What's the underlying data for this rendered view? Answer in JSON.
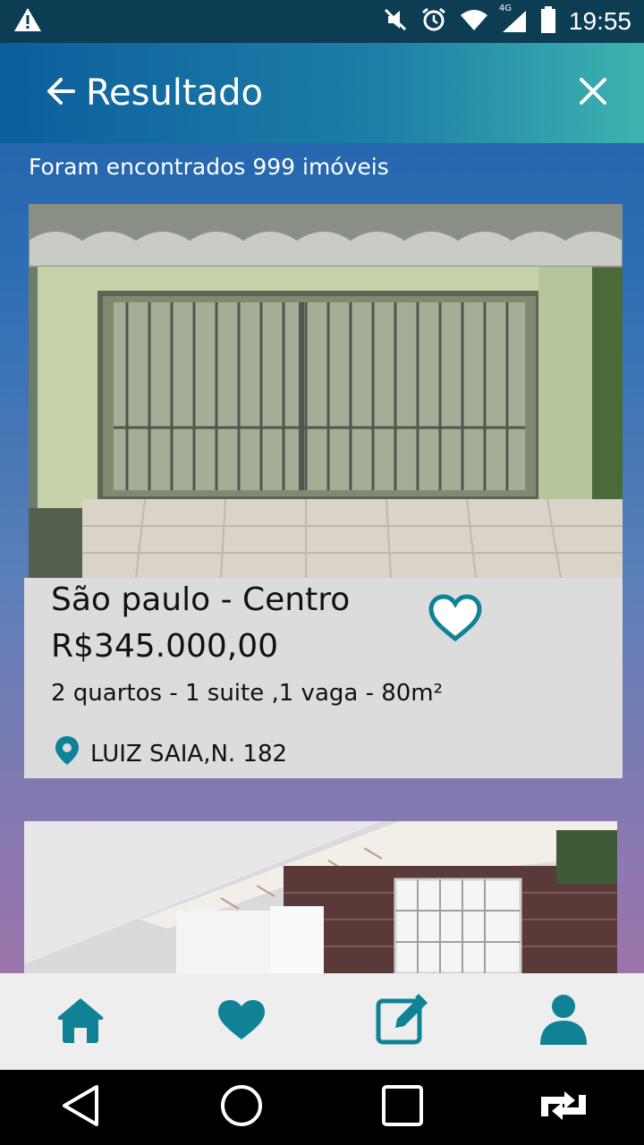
{
  "status_bar": {
    "time": "19:55",
    "network_label": "4G",
    "icons": [
      "warning-icon",
      "mute-icon",
      "alarm-icon",
      "wifi-icon",
      "signal-icon",
      "battery-icon"
    ]
  },
  "app_bar": {
    "title": "Resultado",
    "back_icon": "arrow-left-icon",
    "close_icon": "close-icon"
  },
  "results": {
    "count_text": "Foram encontrados 999 imóveis"
  },
  "listings": [
    {
      "location": "São paulo - Centro",
      "price": "R$345.000,00",
      "features": "2 quartos - 1 suite ,1 vaga - 80m²",
      "address": "LUIZ SAIA,N. 182",
      "favorite": false
    }
  ],
  "bottom_nav": {
    "items": [
      "home-icon",
      "heart-icon",
      "edit-icon",
      "profile-icon"
    ]
  },
  "colors": {
    "accent": "#0f8296",
    "app_bar_start": "#0b5f9c",
    "app_bar_end": "#3cb3b0",
    "card_bg": "#dcdcdc"
  }
}
